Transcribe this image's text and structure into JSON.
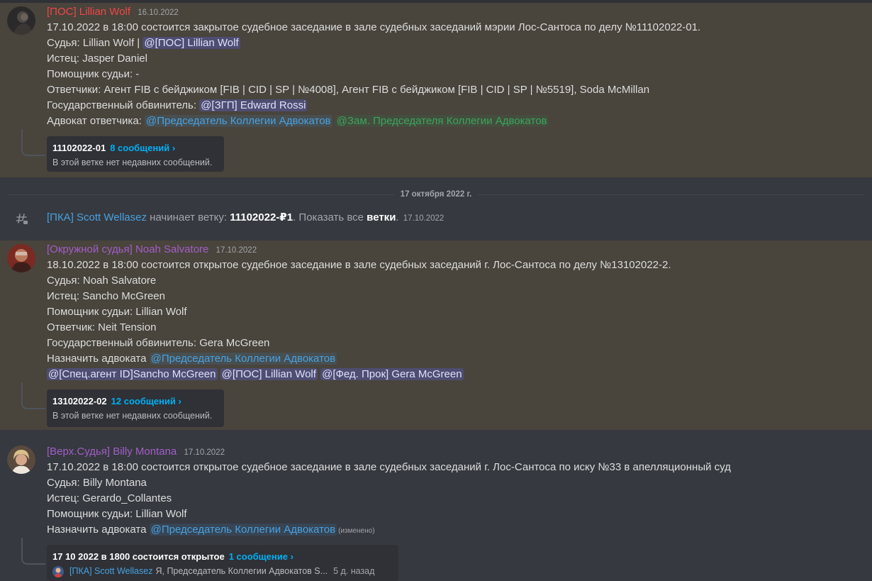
{
  "date_divider": "17 октября 2022 г.",
  "messages": [
    {
      "author": "[ПОС] Lillian Wolf",
      "author_color": "#f04747",
      "timestamp": "16.10.2022",
      "avatar": "dark-portrait",
      "lines": {
        "l1": "17.10.2022 в 18:00 состоится закрытое судебное заседание в зале судебных заседаний мэрии Лос-Сантоса по делу №11102022-01.",
        "l2_prefix": "Судья: Lillian Wolf | ",
        "l2_mention": "@[ПОС] Lillian Wolf",
        "l3": "Истец: Jasper Daniel",
        "l4": "Помощник судьи: -",
        "l5": "Ответчики: Агент FIB с бейджиком [FIB | CID | SP | №4008], Агент FIB с бейджиком [FIB | CID | SP | №5519], Soda McMillan",
        "l6_prefix": "Государственный обвинитель: ",
        "l6_mention": "@[ЗГП] Edward Rossi",
        "l7_prefix": "Адвокат ответчика: ",
        "l7_mention1": "@Председатель Коллегии Адвокатов",
        "l7_mention2": "@Зам. Председателя Коллегии Адвокатов"
      },
      "thread": {
        "name": "11102022-01",
        "count": "8 сообщений ›",
        "subtitle": "В этой ветке нет недавних сообщений."
      }
    },
    {
      "author": "[Окружной судья] Noah Salvatore",
      "author_color": "#a25ec8",
      "timestamp": "17.10.2022",
      "avatar": "red-portrait",
      "lines": {
        "l1": "18.10.2022 в 18:00 состоится открытое судебное заседание в зале судебных заседаний г. Лос-Сантоса по делу №13102022-2.",
        "l2": "Судья: Noah Salvatore",
        "l3": "Истец: Sancho McGreen",
        "l4": "Помощник судьи: Lillian Wolf",
        "l5": "Ответчик: Neit Tension",
        "l6": "Государственный обвинитель: Gera McGreen",
        "l7_prefix": "Назначить адвоката ",
        "l7_mention": "@Председатель Коллегии Адвокатов",
        "l8_mention1": "@[Спец.агент ID]Sancho McGreen",
        "l8_mention2": "@[ПОС] Lillian Wolf",
        "l8_mention3": "@[Фед. Прок] Gera McGreen"
      },
      "thread": {
        "name": "13102022-02",
        "count": "12 сообщений ›",
        "subtitle": "В этой ветке нет недавних сообщений."
      }
    },
    {
      "author": "[Верх.Судья] Billy Montana",
      "author_color": "#a25ec8",
      "timestamp": "17.10.2022",
      "avatar": "blond-portrait",
      "lines": {
        "l1": "17.10.2022 в 18:00 состоится открытое судебное заседание в зале судебных заседаний г. Лос-Сантоса по иску №33 в апелляционный суд",
        "l2": "Судья: Billy Montana",
        "l3": "Истец: Gerardo_Collantes",
        "l4": "Помощник судьи: Lillian Wolf",
        "l5_prefix": "Назначить адвоката ",
        "l5_mention": "@Председатель Коллегии Адвокатов",
        "l5_edited": "(изменено)"
      },
      "thread": {
        "name": "17 10 2022 в 1800 состоится открытое",
        "count": "1 сообщение ›",
        "sub_author": "[ПКА] Scott Wellasez",
        "sub_text": "Я, Председатель Коллегии Адвокатов S...",
        "sub_age": "5 д. назад"
      }
    }
  ],
  "system": {
    "icon": "thread-icon",
    "author": "[ПКА] Scott Wellasez",
    "action": " начинает ветку: ",
    "thread_name": "11102022-₽1",
    "dot": ". ",
    "show_all": "Показать все ",
    "threads_word": "ветки",
    "tail": ".",
    "timestamp": "17.10.2022"
  },
  "colors": {
    "background": "#36393f",
    "highlight": "#49443c",
    "mention_link": "#48a1e0",
    "thread_count": "#00aff4"
  }
}
